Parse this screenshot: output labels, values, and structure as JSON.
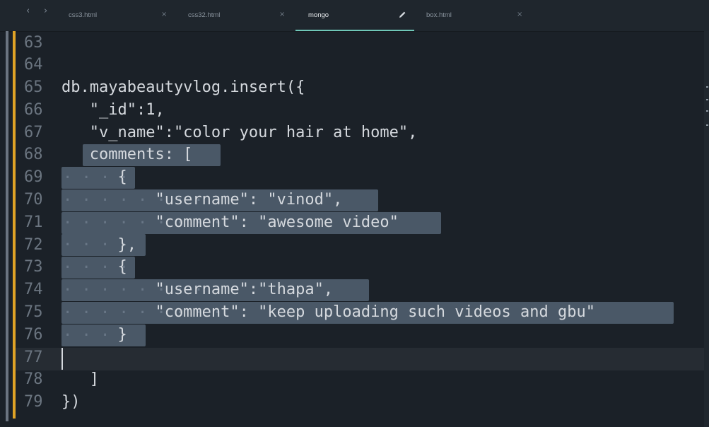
{
  "tabs": [
    {
      "label": "css3.html",
      "active": false
    },
    {
      "label": "css32.html",
      "active": false
    },
    {
      "label": "mongo",
      "active": true,
      "modified": true
    },
    {
      "label": "box.html",
      "active": false
    }
  ],
  "navigation": {
    "back": "‹",
    "forward": "›"
  },
  "close_glyph": "×",
  "editor": {
    "current_line": "77",
    "lines": [
      {
        "number": "63",
        "text": ""
      },
      {
        "number": "64",
        "text": ""
      },
      {
        "number": "65",
        "text": "db.mayabeautyvlog.insert({"
      },
      {
        "number": "66",
        "text": "   \"_id\":1,"
      },
      {
        "number": "67",
        "text": "   \"v_name\":\"color your hair at home\","
      },
      {
        "number": "68",
        "text": "   comments: ["
      },
      {
        "number": "69",
        "text": "      {"
      },
      {
        "number": "70",
        "text": "          \"username\": \"vinod\","
      },
      {
        "number": "71",
        "text": "          \"comment\": \"awesome video\""
      },
      {
        "number": "72",
        "text": "      },"
      },
      {
        "number": "73",
        "text": "      {"
      },
      {
        "number": "74",
        "text": "          \"username\":\"thapa\","
      },
      {
        "number": "75",
        "text": "          \"comment\": \"keep uploading such videos and gbu\""
      },
      {
        "number": "76",
        "text": "      }"
      },
      {
        "number": "77",
        "text": ""
      },
      {
        "number": "78",
        "text": "   ]"
      },
      {
        "number": "79",
        "text": "})"
      }
    ]
  },
  "colors": {
    "background": "#1b2128",
    "selection": "#4a5867",
    "text": "#d5d9de",
    "line_number": "#6b7580",
    "modified_marker": "#e0a326",
    "active_tab_underline": "#6fc7b8"
  }
}
